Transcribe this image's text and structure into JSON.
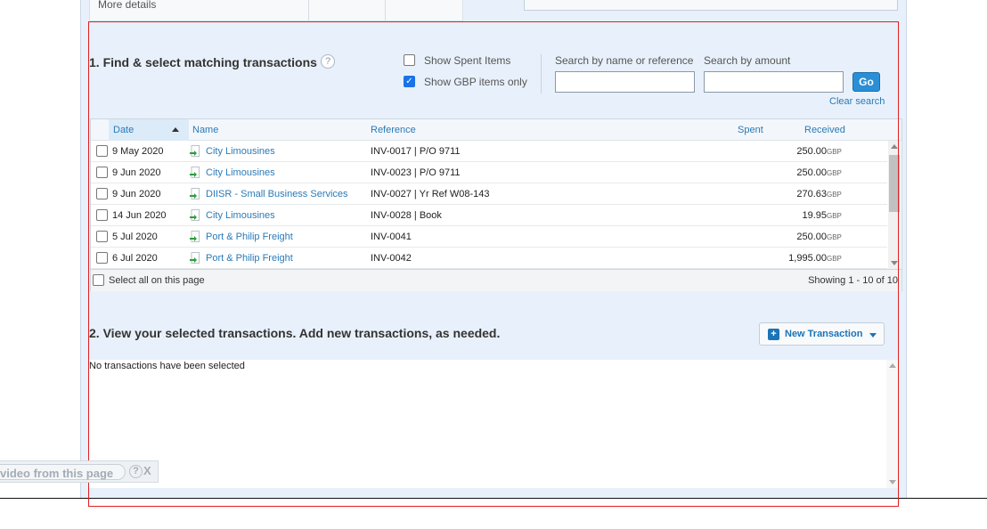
{
  "top": {
    "more_details": "More details"
  },
  "section1": {
    "title": "1. Find & select matching transactions",
    "help": "?",
    "show_spent_label": "Show Spent Items",
    "show_spent_checked": false,
    "show_gbp_label": "Show GBP items only",
    "show_gbp_checked": true,
    "search_name_label": "Search by name or reference",
    "search_name_value": "",
    "search_amount_label": "Search by amount",
    "search_amount_value": "",
    "go_label": "Go",
    "clear_search": "Clear search"
  },
  "grid": {
    "headers": {
      "date": "Date",
      "name": "Name",
      "reference": "Reference",
      "spent": "Spent",
      "received": "Received"
    },
    "rows": [
      {
        "date": "9 May 2020",
        "name": "City Limousines",
        "reference": "INV-0017 | P/O 9711",
        "received": "250.00",
        "currency": "GBP"
      },
      {
        "date": "9 Jun 2020",
        "name": "City Limousines",
        "reference": "INV-0023 | P/O 9711",
        "received": "250.00",
        "currency": "GBP"
      },
      {
        "date": "9 Jun 2020",
        "name": "DIISR - Small Business Services",
        "reference": "INV-0027 | Yr Ref W08-143",
        "received": "270.63",
        "currency": "GBP"
      },
      {
        "date": "14 Jun 2020",
        "name": "City Limousines",
        "reference": "INV-0028 | Book",
        "received": "19.95",
        "currency": "GBP"
      },
      {
        "date": "5 Jul 2020",
        "name": "Port & Philip Freight",
        "reference": "INV-0041",
        "received": "250.00",
        "currency": "GBP"
      },
      {
        "date": "6 Jul 2020",
        "name": "Port & Philip Freight",
        "reference": "INV-0042",
        "received": "1,995.00",
        "currency": "GBP"
      }
    ],
    "select_all": "Select all on this page",
    "showing": "Showing 1 - 10 of 10"
  },
  "section2": {
    "title": "2. View your selected transactions. Add new transactions, as needed.",
    "new_transaction": "New Transaction",
    "empty_text": "No transactions have been selected"
  },
  "video_bar": {
    "text": "video from this page",
    "help": "?",
    "close": "X"
  }
}
